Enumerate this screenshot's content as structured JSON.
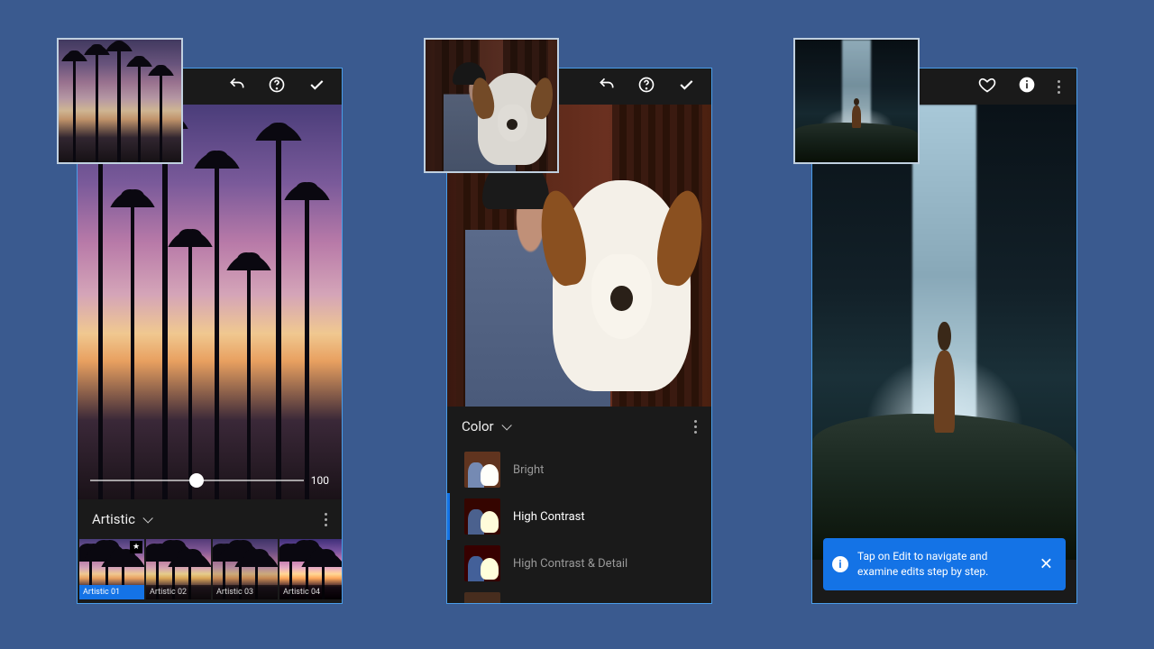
{
  "panel1": {
    "slider_value": "100",
    "section_label": "Artistic",
    "presets": [
      {
        "label": "Artistic 01",
        "selected": true,
        "starred": true
      },
      {
        "label": "Artistic 02",
        "selected": false,
        "starred": false
      },
      {
        "label": "Artistic 03",
        "selected": false,
        "starred": false
      },
      {
        "label": "Artistic 04",
        "selected": false,
        "starred": false
      }
    ]
  },
  "panel2": {
    "section_label": "Color",
    "items": [
      {
        "label": "Bright",
        "selected": false
      },
      {
        "label": "High Contrast",
        "selected": true
      },
      {
        "label": "High Contrast & Detail",
        "selected": false
      }
    ]
  },
  "panel3": {
    "tip": "Tap on Edit to navigate and examine edits step by step."
  },
  "icons": {
    "undo": "undo-icon",
    "help": "help-icon",
    "apply": "checkmark-icon",
    "heart": "heart-icon",
    "info": "info-icon",
    "more": "more-vertical-icon",
    "close": "close-icon",
    "tip": "info-circle-icon",
    "star": "star-icon",
    "chevron_down": "chevron-down-icon"
  },
  "colors": {
    "accent": "#1473e6",
    "panel_border": "#4a9de8",
    "bg": "#3a5a8f"
  }
}
